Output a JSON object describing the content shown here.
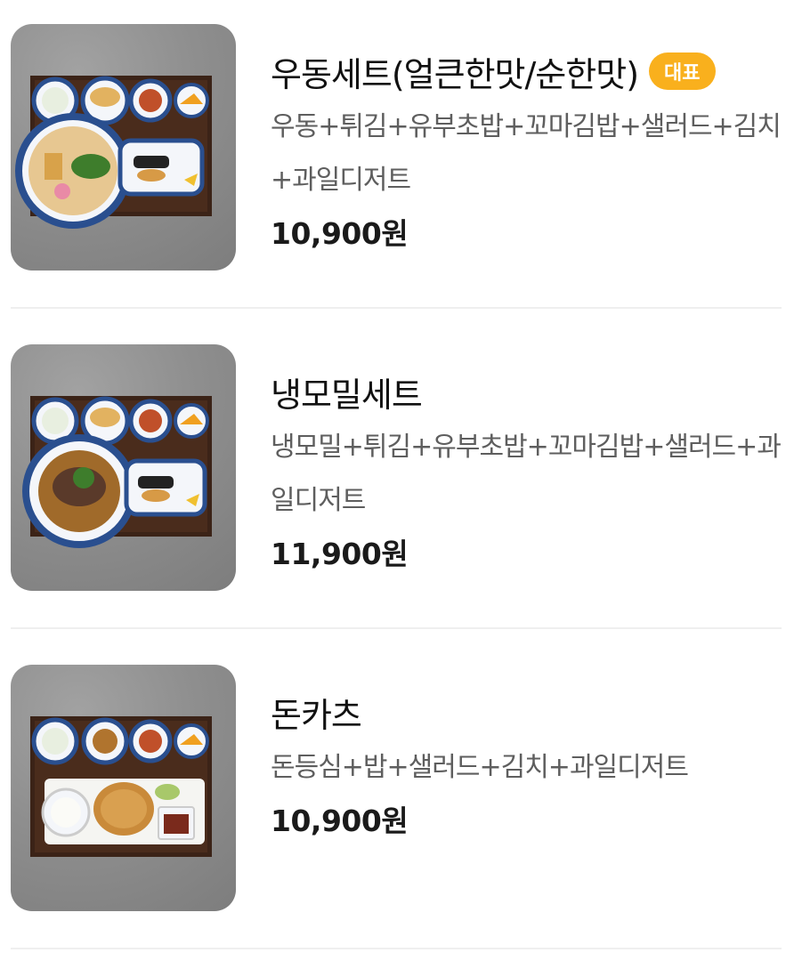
{
  "menu": {
    "items": [
      {
        "title": "우동세트(얼큰한맛/순한맛)",
        "badge": "대표",
        "description": "우동+튀김+유부초밥+꼬마김밥+샐러드+김치+과일디저트",
        "price": "10,900원"
      },
      {
        "title": "냉모밀세트",
        "description": "냉모밀+튀김+유부초밥+꼬마김밥+샐러드+과일디저트",
        "price": "11,900원"
      },
      {
        "title": "돈카츠",
        "description": "돈등심+밥+샐러드+김치+과일디저트",
        "price": "10,900원"
      }
    ]
  },
  "colors": {
    "badge_bg": "#f9b01d",
    "description": "#5e5e5e",
    "divider": "#efefef",
    "tray": "#3b2317"
  }
}
